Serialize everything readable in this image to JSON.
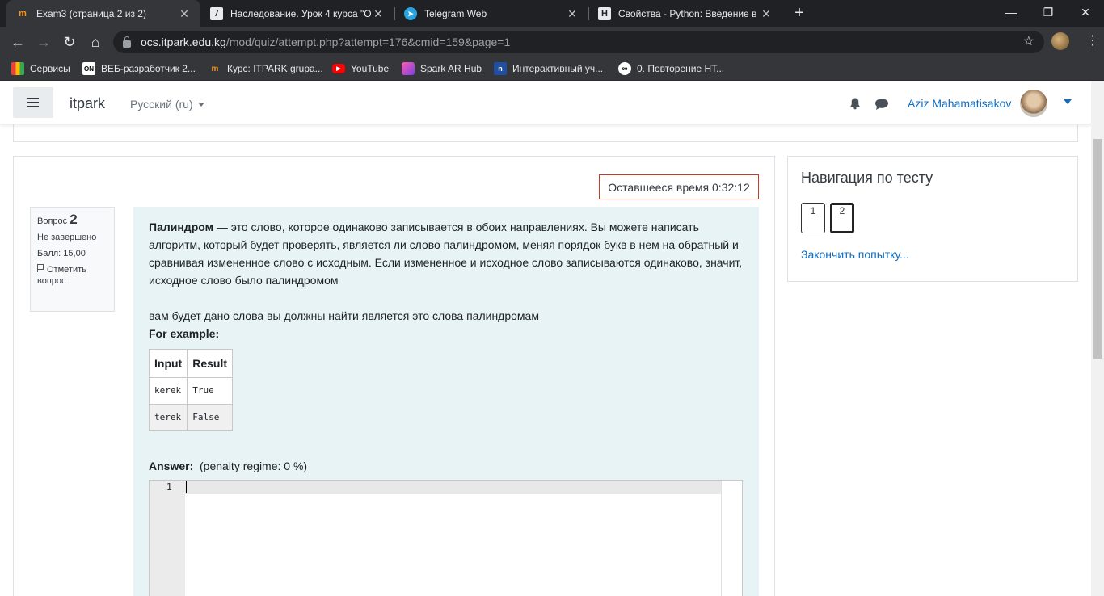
{
  "browser": {
    "tabs": [
      {
        "title": "Exam3 (страница 2 из 2)",
        "active": true
      },
      {
        "title": "Наследование. Урок 4 курса \"О",
        "active": false
      },
      {
        "title": "Telegram Web",
        "active": false
      },
      {
        "title": "Свойства - Python: Введение в О",
        "active": false
      }
    ],
    "new_tab": "+",
    "window_controls": [
      "—",
      "❐",
      "✕"
    ],
    "url_host": "ocs.itpark.edu.kg",
    "url_path": "/mod/quiz/attempt.php?attempt=176&cmid=159&page=1",
    "bookmarks": [
      {
        "label": "Сервисы"
      },
      {
        "label": "ВЕБ-разработчик 2..."
      },
      {
        "label": "Курс: ITPARK grupa..."
      },
      {
        "label": "YouTube"
      },
      {
        "label": "Spark AR Hub"
      },
      {
        "label": "Интерактивный уч..."
      },
      {
        "label": "0. Повторение НТ..."
      }
    ]
  },
  "site": {
    "brand": "itpark",
    "language": "Русский (ru)",
    "user_name": "Aziz Mahamatisakov"
  },
  "quiz": {
    "timer": "Оставшееся время 0:32:12",
    "info": {
      "question_label": "Вопрос",
      "question_number": "2",
      "status": "Не завершено",
      "score": "Балл: 15,00",
      "flag_label": "Отметить вопрос"
    },
    "question": {
      "term": "Палиндром",
      "definition": " — это слово, которое одинаково записывается в обоих направлениях. Вы можете написать алгоритм, который будет проверять, является ли слово палиндромом, меняя порядок букв в нем на обратный и сравнивая измененное слово с исходным. Если измененное и исходное слово записываются одинаково, значит, исходное слово было палиндромом",
      "task": "вам будет дано слова вы должны найти является это слова палиндромам",
      "example_heading": "For example:",
      "table_headers": [
        "Input",
        "Result"
      ],
      "table_rows": [
        [
          "kerek",
          "True"
        ],
        [
          "terek",
          "False"
        ]
      ]
    },
    "answer_label": "Answer:",
    "penalty": "(penalty regime: 0 %)",
    "editor_line": "1"
  },
  "navigation": {
    "title": "Навигация по тесту",
    "buttons": [
      "1",
      "2"
    ],
    "finish_link": "Закончить попытку..."
  }
}
